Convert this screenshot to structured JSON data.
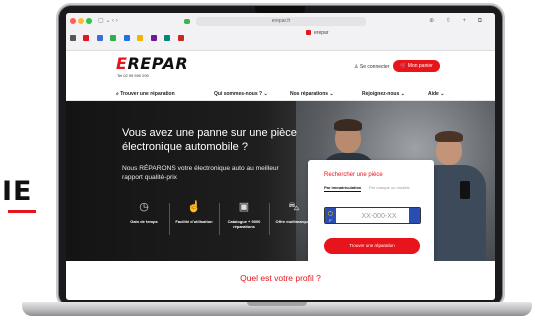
{
  "left_fragment": {
    "big_text": "IE"
  },
  "browser": {
    "url": "erepar.fr",
    "tab_label": "erepar",
    "left_icons": "▢ ⌄ ‹ ›",
    "right_icons": "⊕ ⇧ + ⧉"
  },
  "header": {
    "logo_first": "E",
    "logo_rest": "REPAR",
    "phone": "Tel 02 99 590 290",
    "login_label": "♙  Se connecter",
    "cart_label": "🛒 Mon panier"
  },
  "nav": {
    "items": [
      {
        "label": "⌕  Trouver une réparation"
      },
      {
        "label": "Qui sommes-nous ? ⌄"
      },
      {
        "label": "Nos réparations ⌄"
      },
      {
        "label": "Rejoignez-nous ⌄"
      },
      {
        "label": "Aide ⌄"
      }
    ]
  },
  "hero": {
    "title": "Vous avez une panne sur une pièce électronique automobile ?",
    "subtitle": "Nous RÉPARONS votre électronique auto au meilleur rapport qualité-prix",
    "features": [
      {
        "icon": "piggy-bank-icon",
        "glyph": "◷",
        "label": "Gain de temps"
      },
      {
        "icon": "hand-click-icon",
        "glyph": "☝",
        "label": "Facilité d'utilisation"
      },
      {
        "icon": "catalogue-icon",
        "glyph": "▣",
        "label": "Catalogue + 9000 réparations"
      },
      {
        "icon": "car-icon",
        "glyph": "⛍",
        "label": "Offre multimarques"
      }
    ]
  },
  "search_card": {
    "title": "Rechercher une pièce",
    "tab_active": "Par immatriculation",
    "tab_inactive": "Par marque ou modèle",
    "plate_country": "F",
    "plate_placeholder": "XX-000-XX",
    "button_label": "Trouver une réparation"
  },
  "profile": {
    "title": "Quel est votre profil ?"
  },
  "colors": {
    "brand_red": "#e8141c",
    "hero_dark": "#1e1e1e"
  }
}
